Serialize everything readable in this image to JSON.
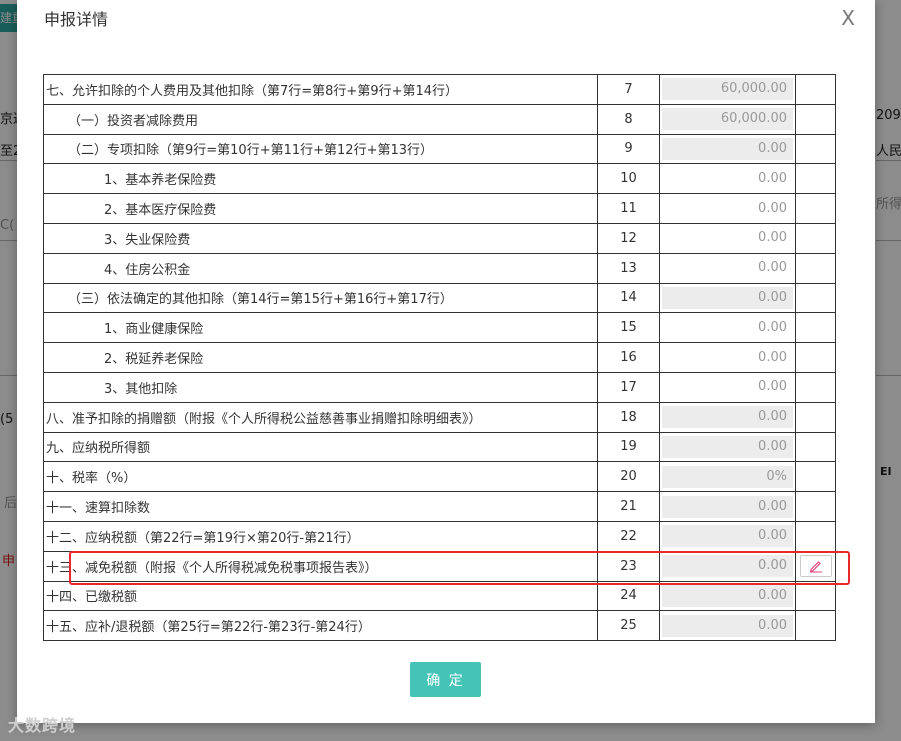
{
  "background": {
    "tab_fragment": "建重",
    "fragments": [
      "京达",
      "至2",
      "C(",
      "(5",
      "后",
      "申",
      "209",
      "人民市",
      "所得",
      "EI"
    ]
  },
  "modal": {
    "title": "申报详情",
    "close_label": "X",
    "confirm_label": "确 定"
  },
  "rows": [
    {
      "name": "七、允许扣除的个人费用及其他扣除（第7行=第8行+第9行+第14行）",
      "num": "7",
      "value": "60,000.00",
      "readonly": true,
      "indent": 0
    },
    {
      "name": "（一）投资者减除费用",
      "num": "8",
      "value": "60,000.00",
      "readonly": true,
      "indent": 1
    },
    {
      "name": "（二）专项扣除（第9行=第10行+第11行+第12行+第13行）",
      "num": "9",
      "value": "0.00",
      "readonly": true,
      "indent": 1
    },
    {
      "name": "1、基本养老保险费",
      "num": "10",
      "value": "0.00",
      "readonly": false,
      "indent": 2
    },
    {
      "name": "2、基本医疗保险费",
      "num": "11",
      "value": "0.00",
      "readonly": false,
      "indent": 2
    },
    {
      "name": "3、失业保险费",
      "num": "12",
      "value": "0.00",
      "readonly": false,
      "indent": 2
    },
    {
      "name": "4、住房公积金",
      "num": "13",
      "value": "0.00",
      "readonly": false,
      "indent": 2
    },
    {
      "name": "（三）依法确定的其他扣除（第14行=第15行+第16行+第17行）",
      "num": "14",
      "value": "0.00",
      "readonly": true,
      "indent": 1
    },
    {
      "name": "1、商业健康保险",
      "num": "15",
      "value": "0.00",
      "readonly": false,
      "indent": 2
    },
    {
      "name": "2、税延养老保险",
      "num": "16",
      "value": "0.00",
      "readonly": false,
      "indent": 2
    },
    {
      "name": "3、其他扣除",
      "num": "17",
      "value": "0.00",
      "readonly": false,
      "indent": 2
    },
    {
      "name": "八、准予扣除的捐赠额（附报《个人所得税公益慈善事业捐赠扣除明细表》）",
      "num": "18",
      "value": "0.00",
      "readonly": true,
      "indent": 0
    },
    {
      "name": "九、应纳税所得额",
      "num": "19",
      "value": "0.00",
      "readonly": true,
      "indent": 0
    },
    {
      "name": "十、税率（%）",
      "num": "20",
      "value": "0%",
      "readonly": true,
      "indent": 0
    },
    {
      "name": "十一、速算扣除数",
      "num": "21",
      "value": "0.00",
      "readonly": true,
      "indent": 0
    },
    {
      "name": "十二、应纳税额（第22行=第19行×第20行-第21行）",
      "num": "22",
      "value": "0.00",
      "readonly": true,
      "indent": 0
    },
    {
      "name": "十三、减免税额（附报《个人所得税减免税事项报告表》）",
      "num": "23",
      "value": "0.00",
      "readonly": true,
      "indent": 0,
      "editable": true
    },
    {
      "name": "十四、已缴税额",
      "num": "24",
      "value": "0.00",
      "readonly": true,
      "indent": 0
    },
    {
      "name": "十五、应补/退税额（第25行=第22行-第23行-第24行）",
      "num": "25",
      "value": "0.00",
      "readonly": true,
      "indent": 0
    }
  ],
  "edit_icon": "pencil-icon",
  "watermark": "大数跨境",
  "colors": {
    "accent": "#45c3b7",
    "highlight": "#e8282b",
    "tab": "#2fa9a4"
  }
}
